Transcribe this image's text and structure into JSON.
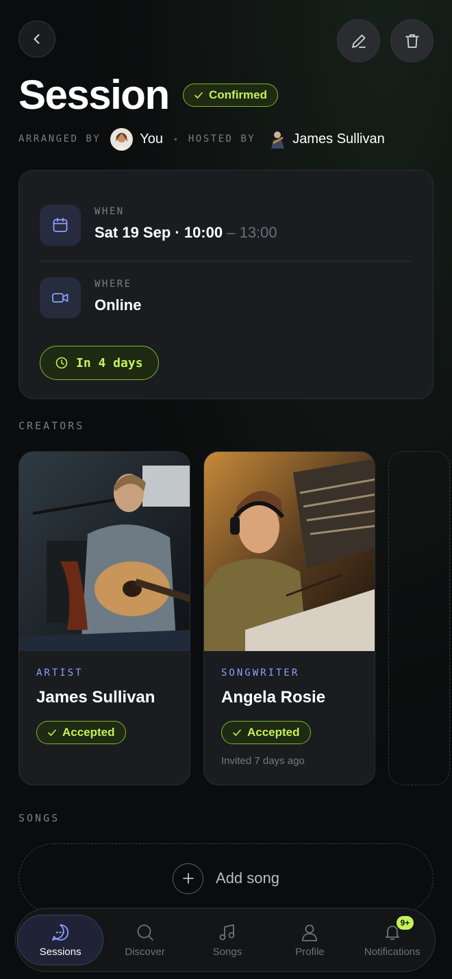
{
  "header": {
    "title": "Session",
    "status": "Confirmed"
  },
  "meta": {
    "arranged_label": "ARRANGED BY",
    "arranged_name": "You",
    "separator": "•",
    "hosted_label": "HOSTED BY",
    "hosted_name": "James Sullivan"
  },
  "details": {
    "when_label": "WHEN",
    "when_value": "Sat 19 Sep · 10:00",
    "when_end": "– 13:00",
    "where_label": "WHERE",
    "where_value": "Online",
    "countdown": "In 4 days"
  },
  "creators": {
    "section_label": "CREATORS",
    "items": [
      {
        "role": "ARTIST",
        "name": "James Sullivan",
        "status": "Accepted",
        "note": ""
      },
      {
        "role": "SONGWRITER",
        "name": "Angela Rosie",
        "status": "Accepted",
        "note": "Invited 7 days ago"
      }
    ]
  },
  "songs": {
    "section_label": "SONGS",
    "add_label": "Add song"
  },
  "nav": {
    "items": [
      {
        "label": "Sessions",
        "icon": "chat-bubble-icon",
        "active": true
      },
      {
        "label": "Discover",
        "icon": "search-icon"
      },
      {
        "label": "Songs",
        "icon": "music-note-icon"
      },
      {
        "label": "Profile",
        "icon": "person-icon"
      },
      {
        "label": "Notifications",
        "icon": "bell-icon",
        "badge": "9+"
      }
    ]
  },
  "colors": {
    "accent_green": "#c4f25a",
    "accent_blue": "#8da0ff",
    "background": "#0b0c0d"
  }
}
